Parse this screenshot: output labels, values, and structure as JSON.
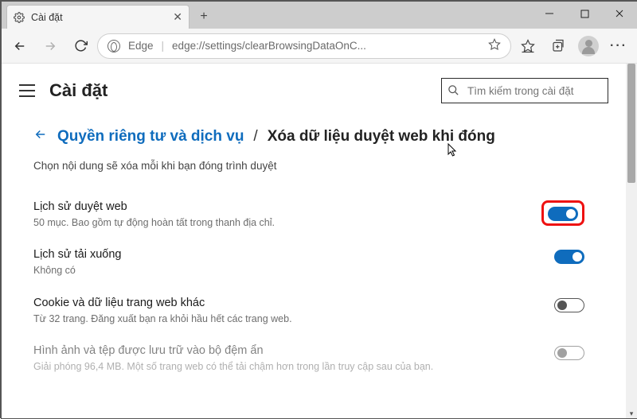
{
  "window": {
    "tab_title": "Cài đặt",
    "address_label": "Edge",
    "address_url": "edge://settings/clearBrowsingDataOnC..."
  },
  "settings": {
    "title": "Cài đặt",
    "search_placeholder": "Tìm kiếm trong cài đặt"
  },
  "breadcrumb": {
    "parent": "Quyền riêng tư và dịch vụ",
    "separator": "/",
    "current": "Xóa dữ liệu duyệt web khi đóng"
  },
  "hint": "Chọn nội dung sẽ xóa mỗi khi bạn đóng trình duyệt",
  "options": [
    {
      "title": "Lịch sử duyệt web",
      "desc": "50 mục. Bao gồm tự động hoàn tất trong thanh địa chỉ.",
      "on": true,
      "highlight": true
    },
    {
      "title": "Lịch sử tải xuống",
      "desc": "Không có",
      "on": true,
      "highlight": false
    },
    {
      "title": "Cookie và dữ liệu trang web khác",
      "desc": "Từ 32 trang. Đăng xuất bạn ra khỏi hầu hết các trang web.",
      "on": false,
      "highlight": false
    },
    {
      "title": "Hình ảnh và tệp được lưu trữ vào bộ đệm ẩn",
      "desc": "Giải phóng 96,4 MB. Một số trang web có thể tải chậm hơn trong lần truy cập sau của bạn.",
      "on": false,
      "highlight": false
    }
  ]
}
